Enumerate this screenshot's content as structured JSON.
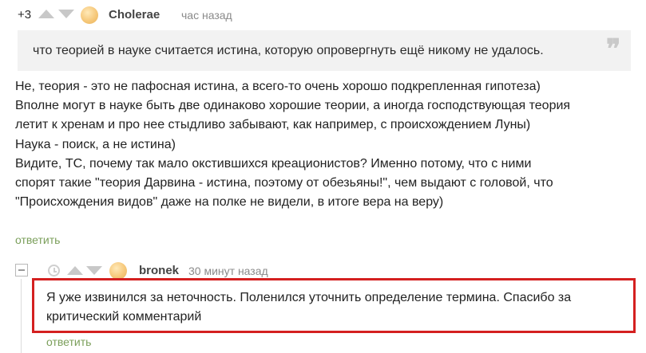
{
  "comment1": {
    "rating": "+3",
    "username": "Cholerae",
    "timestamp": "час назад",
    "quote": "что теорией в науке считается истина, которую опровергнуть ещё никому не удалось.",
    "quote_icon": "quote-icon",
    "body_lines": [
      "Не, теория - это не пафосная истина, а всего-то очень хорошо подкрепленная гипотеза)",
      "Вполне могут в науке быть две одинаково хорошие теории, а иногда господствующая теория",
      "летит к хренам и про нее стыдливо забывают, как например, с происхождением Луны)",
      "Наука - поиск, а не истина)",
      "Видите, ТС, почему так мало окстившихся креационистов? Именно потому, что с ними",
      "спорят такие \"теория Дарвина - истина, поэтому от обезьяны!\", чем выдают с головой, что",
      "\"Происхождения видов\" даже на полке не видели, в итоге вера на веру)"
    ],
    "reply_label": "ответить"
  },
  "comment2": {
    "username": "bronek",
    "timestamp": "30 минут назад",
    "body_lines": [
      "Я уже извинился за неточность. Поленился уточнить определение термина. Спасибо за",
      "критический комментарий"
    ],
    "reply_label": "ответить",
    "highlight_color": "#d42020"
  },
  "colors": {
    "reply_link": "#7b9f5b",
    "quote_bg": "#f2f2f2",
    "vote_arrow": "#c8c8c8"
  }
}
